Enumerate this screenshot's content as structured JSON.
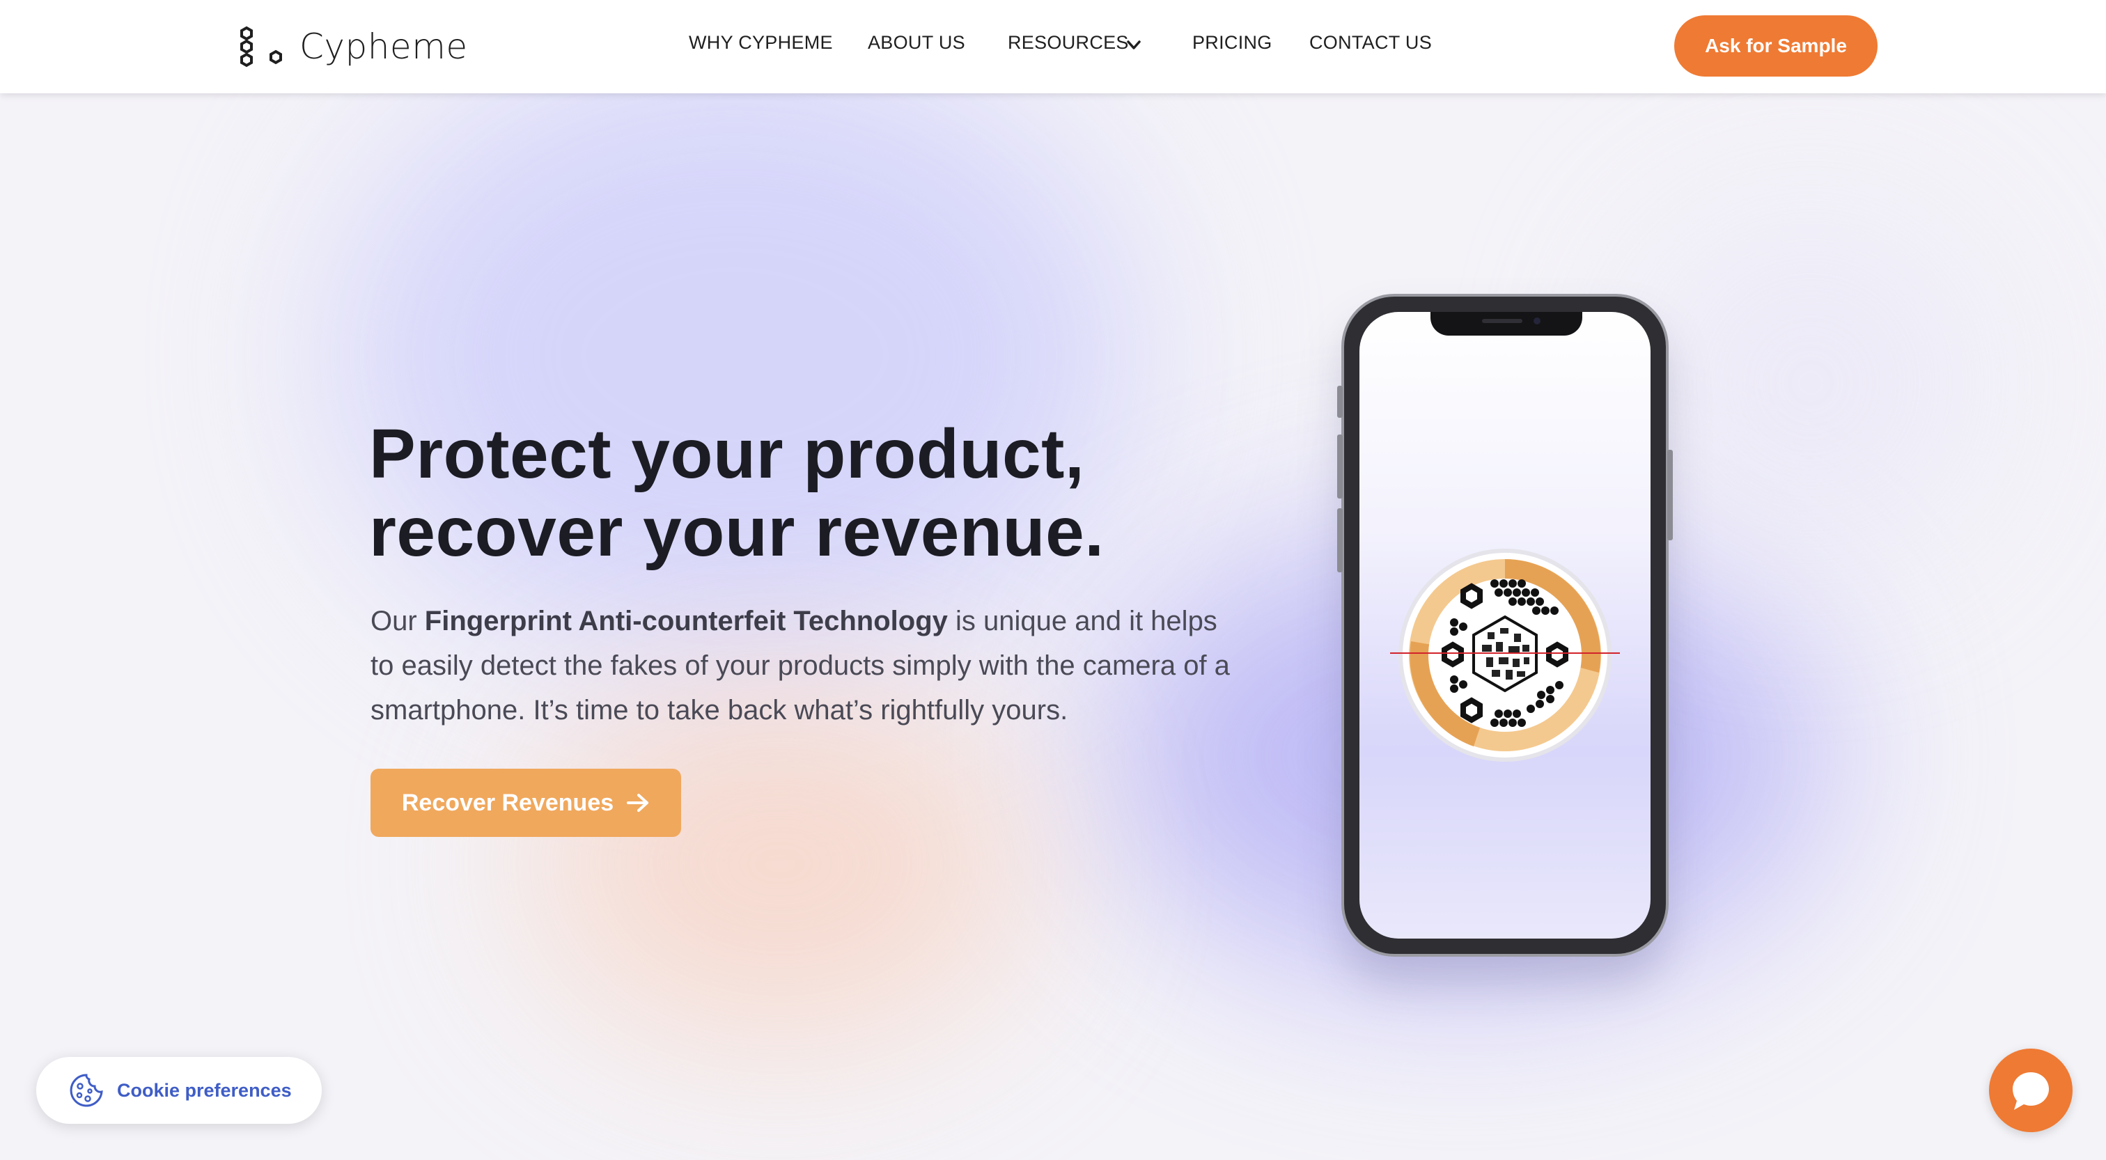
{
  "brand": {
    "name": "Cypheme",
    "logo_icon": "hexagon-cluster-icon"
  },
  "nav": {
    "items": [
      {
        "label": "WHY CYPHEME"
      },
      {
        "label": "ABOUT US"
      },
      {
        "label": "RESOURCES",
        "icon": "chevron-down-icon"
      },
      {
        "label": "PRICING"
      },
      {
        "label": "CONTACT US"
      }
    ],
    "cta_label": "Ask for Sample"
  },
  "hero": {
    "title_line1": "Protect your product,",
    "title_line2": "recover your revenue.",
    "body_prefix": "Our ",
    "body_bold": "Fingerprint Anti-counterfeit Technology",
    "body_suffix": " is unique and it helps to easily detect the fakes of your products simply with the camera of a smartphone. It’s time to take back what’s rightfully yours.",
    "button_label": "Recover Revenues",
    "button_icon": "arrow-right-icon"
  },
  "phone": {
    "screen_image": "fingerprint-seal-icon"
  },
  "cookie": {
    "label": "Cookie preferences",
    "icon": "cookie-icon"
  },
  "chat": {
    "icon": "chat-bubble-icon"
  },
  "colors": {
    "accent_orange": "#ef7a33",
    "button_orange_light": "#f0a85d",
    "cookie_blue": "#3f5dc6",
    "title_dark": "#1c1c24",
    "body_text": "#4a4a56"
  }
}
